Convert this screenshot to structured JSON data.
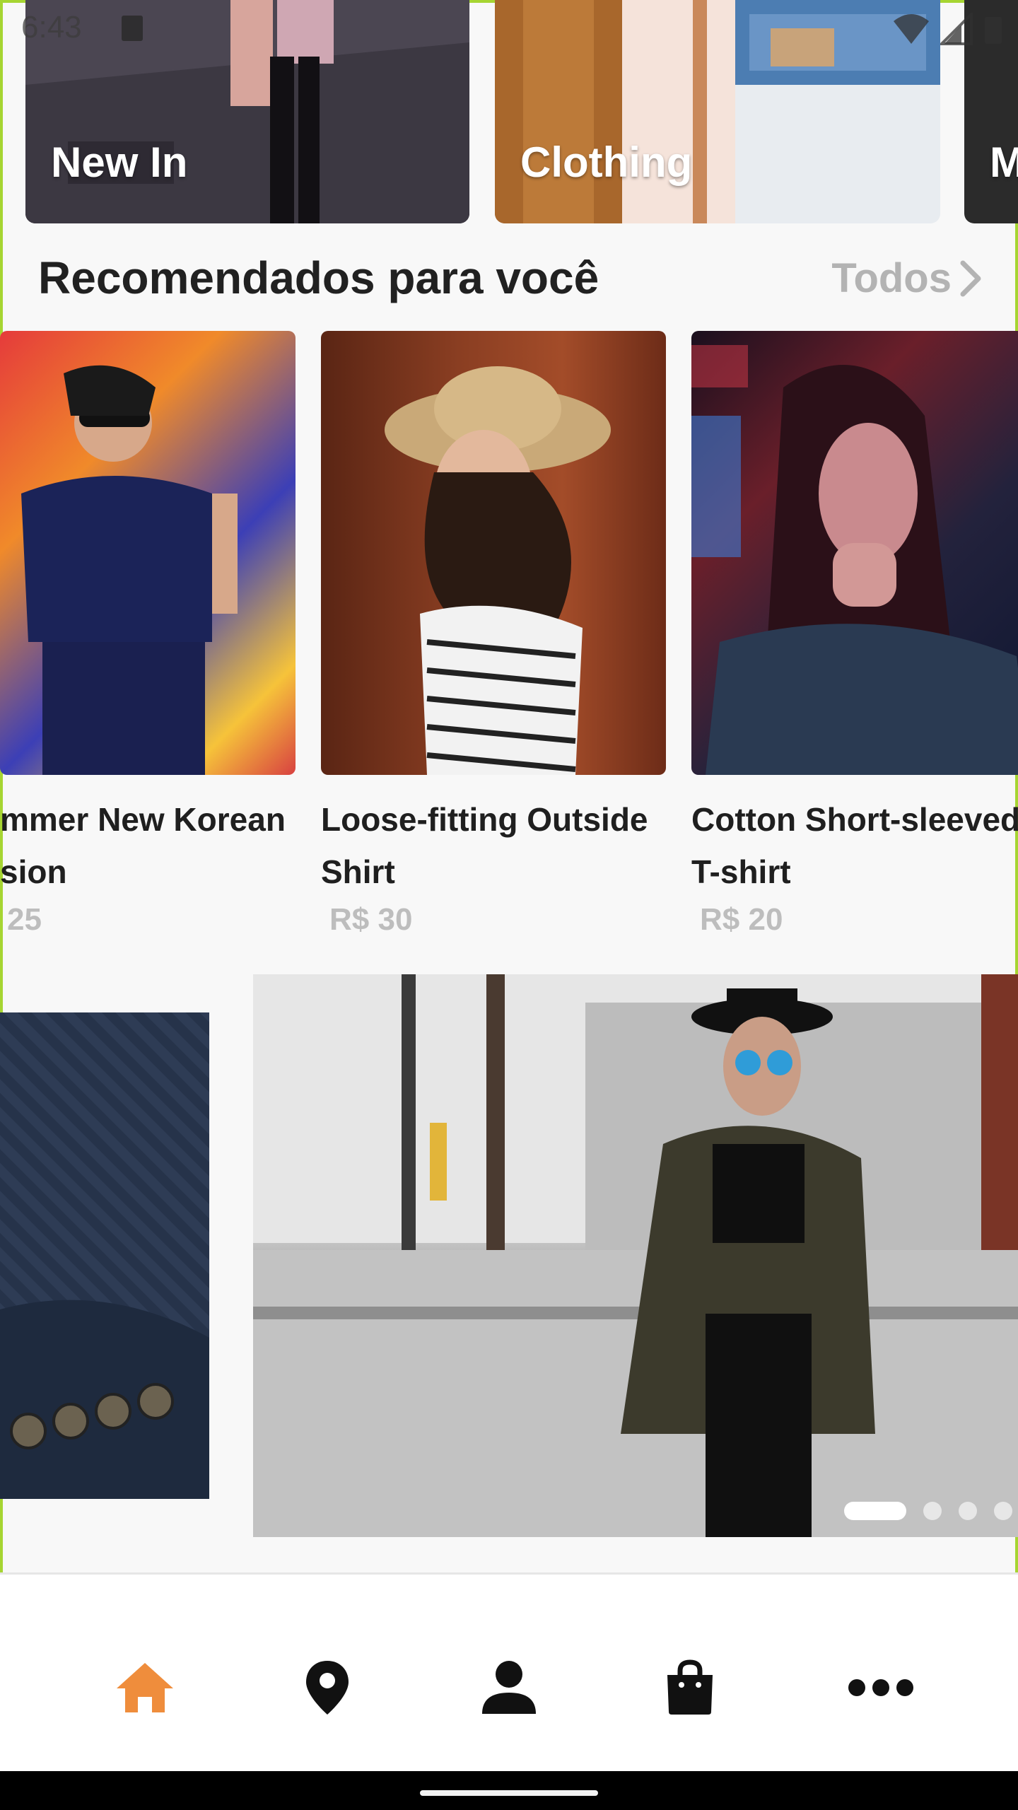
{
  "status_bar": {
    "time": "6:43"
  },
  "categories": [
    {
      "label": "New In"
    },
    {
      "label": "Clothing"
    },
    {
      "label": "M"
    }
  ],
  "recommended": {
    "title": "Recomendados para você",
    "see_all": "Todos",
    "products": [
      {
        "name_line1": "mmer New Korean",
        "name_line2": "sion",
        "price": "25"
      },
      {
        "name_line1": "Loose-fitting Outside",
        "name_line2": "Shirt",
        "price": "R$ 30"
      },
      {
        "name_line1": "Cotton Short-sleeved",
        "name_line2": "T-shirt",
        "price": "R$ 20"
      }
    ]
  },
  "banner": {
    "slide_count": 4,
    "active_slide": 1
  },
  "nav": {
    "items": [
      "home-icon",
      "location-pin-icon",
      "profile-icon",
      "shopping-bag-icon",
      "more-icon"
    ],
    "active": "home-icon",
    "active_color": "#ef8d3c",
    "inactive_color": "#111111"
  },
  "colors": {
    "accent": "#ef8d3c",
    "background": "#f8f8f8",
    "frame": "#a6d532"
  }
}
